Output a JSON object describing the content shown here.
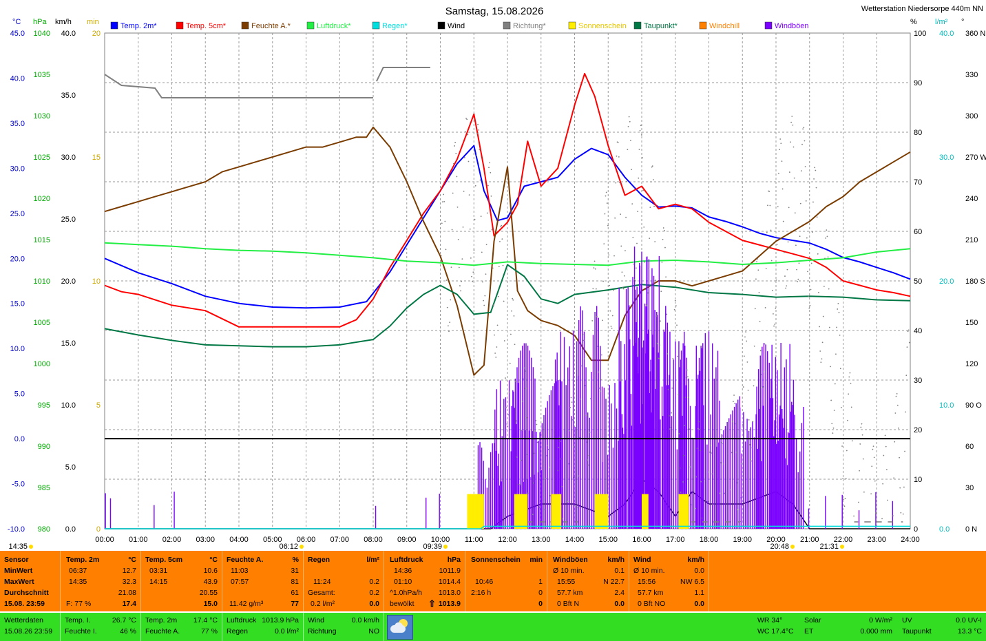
{
  "header": {
    "title": "Samstag, 15.08.2026",
    "station": "Wetterstation Niedersorpe 440m NN"
  },
  "axis_units": {
    "temp": "°C",
    "hpa": "hPa",
    "kmh": "km/h",
    "min": "min",
    "pct": "%",
    "lm2": "l/m²",
    "deg": "°"
  },
  "legend": [
    {
      "label": "Temp. 2m*",
      "color": "#0000ff"
    },
    {
      "label": "Temp. 5cm*",
      "color": "#ff0000"
    },
    {
      "label": "Feuchte A.*",
      "color": "#7a3c00"
    },
    {
      "label": "Luftdruck*",
      "color": "#22ee44"
    },
    {
      "label": "Regen*",
      "color": "#00dddd"
    },
    {
      "label": "Wind",
      "color": "#000000"
    },
    {
      "label": "Richtung*",
      "color": "#808080"
    },
    {
      "label": "Sonnenschein",
      "color": "#ffee00"
    },
    {
      "label": "Taupunkt*",
      "color": "#007744"
    },
    {
      "label": "Windchill",
      "color": "#ff8000"
    },
    {
      "label": "Windböen",
      "color": "#7a00ff"
    }
  ],
  "chart_data": {
    "type": "line",
    "title": "Samstag, 15.08.2026",
    "x_ticks": [
      "00:00",
      "01:00",
      "02:00",
      "03:00",
      "04:00",
      "05:00",
      "06:00",
      "07:00",
      "08:00",
      "09:00",
      "10:00",
      "11:00",
      "12:00",
      "13:00",
      "14:00",
      "15:00",
      "16:00",
      "17:00",
      "18:00",
      "19:00",
      "20:00",
      "21:00",
      "22:00",
      "23:00",
      "24:00"
    ],
    "axes": {
      "temp_c": {
        "min": -10,
        "max": 45,
        "ticks": [
          "45.0",
          "40.0",
          "35.0",
          "30.0",
          "25.0",
          "20.0",
          "15.0",
          "10.0",
          "5.0",
          "0.0",
          "-5.0",
          "-10.0"
        ]
      },
      "pressure_hpa": {
        "min": 980,
        "max": 1040,
        "ticks": [
          "1040",
          "1035",
          "1030",
          "1025",
          "1020",
          "1015",
          "1010",
          "1005",
          "1000",
          "995",
          "990",
          "985",
          "980"
        ]
      },
      "wind_kmh": {
        "min": 0,
        "max": 40,
        "ticks": [
          "40.0",
          "35.0",
          "30.0",
          "25.0",
          "20.0",
          "15.0",
          "10.0",
          "5.0",
          "0.0"
        ]
      },
      "sun_min": {
        "min": 0,
        "max": 20,
        "ticks": [
          "20",
          "15",
          "10",
          "5",
          "0"
        ]
      },
      "humidity_pct": {
        "min": 0,
        "max": 100,
        "ticks": [
          "100",
          "90",
          "80",
          "70",
          "60",
          "50",
          "40",
          "30",
          "20",
          "10",
          "0"
        ]
      },
      "rain_lm2": {
        "min": 0,
        "max": 40,
        "ticks": [
          "40.0",
          "30.0",
          "20.0",
          "10.0",
          "0.0"
        ]
      },
      "direction_deg": {
        "min": 0,
        "max": 360,
        "ticks": [
          "360 N",
          "330",
          "300",
          "270 W",
          "240",
          "210",
          "180 S",
          "150",
          "120",
          "90 O",
          "60",
          "30",
          "0 N"
        ]
      }
    },
    "series": [
      {
        "name": "Temp. 2m*",
        "axis": "temp_c",
        "color": "#0000ff",
        "x": [
          0,
          1,
          2,
          3,
          4,
          5,
          6,
          7,
          7.8,
          8.5,
          9,
          9.5,
          10,
          10.5,
          11,
          11.3,
          11.7,
          12,
          12.5,
          13,
          13.5,
          14,
          14.5,
          15,
          15.5,
          16,
          16.5,
          17,
          17.5,
          18,
          18.5,
          19,
          19.5,
          20,
          20.5,
          21,
          21.5,
          22,
          22.5,
          23,
          23.5,
          24
        ],
        "y": [
          20.0,
          18.4,
          17.2,
          15.8,
          15.0,
          14.6,
          14.5,
          14.6,
          15.2,
          18.5,
          21.5,
          24.5,
          27.5,
          30.5,
          32.5,
          27.5,
          24.2,
          24.5,
          28.0,
          28.5,
          29.0,
          31.0,
          32.2,
          31.5,
          29.0,
          27.0,
          25.7,
          25.8,
          25.6,
          24.6,
          24.1,
          23.5,
          22.8,
          22.3,
          22.0,
          21.7,
          21.0,
          20.1,
          19.6,
          19.0,
          18.4,
          17.7
        ]
      },
      {
        "name": "Temp. 5cm*",
        "axis": "temp_c",
        "color": "#ff0000",
        "x": [
          0,
          0.5,
          1,
          2,
          3,
          4,
          5,
          6,
          7,
          7.5,
          8,
          8.5,
          9,
          9.5,
          10,
          10.5,
          11,
          11.3,
          11.6,
          12,
          12.3,
          12.6,
          13,
          13.5,
          14,
          14.3,
          14.6,
          15,
          15.5,
          16,
          16.5,
          17,
          17.5,
          18,
          18.5,
          19,
          19.5,
          20,
          20.5,
          21,
          21.5,
          22,
          22.5,
          23,
          23.5,
          24
        ],
        "y": [
          17.0,
          16.3,
          16.0,
          14.8,
          14.2,
          12.4,
          12.4,
          12.4,
          12.4,
          13.2,
          15.5,
          19.0,
          22.0,
          25.0,
          27.5,
          31.0,
          36.0,
          30.0,
          22.5,
          24.0,
          26.0,
          33.0,
          28.0,
          30.0,
          37.0,
          40.5,
          38.0,
          32.5,
          27.0,
          28.0,
          25.5,
          26.0,
          25.5,
          24.0,
          23.0,
          22.0,
          21.5,
          21.0,
          20.5,
          20.0,
          19.0,
          17.5,
          17.0,
          16.5,
          16.2,
          15.8
        ]
      },
      {
        "name": "Feuchte A.*",
        "axis": "humidity_pct",
        "color": "#7a3c00",
        "x": [
          0,
          0.5,
          1,
          1.5,
          2,
          2.5,
          3,
          3.5,
          4,
          4.5,
          5,
          5.5,
          6,
          6.5,
          7,
          7.5,
          7.8,
          8,
          8.5,
          9,
          9.5,
          10,
          10.5,
          11,
          11.3,
          11.6,
          12,
          12.3,
          12.6,
          13,
          13.5,
          14,
          14.5,
          15,
          15.5,
          16,
          16.5,
          17,
          17.5,
          18,
          18.5,
          19,
          19.5,
          20,
          20.5,
          21,
          21.5,
          22,
          22.5,
          23,
          23.5,
          24
        ],
        "y": [
          64,
          65,
          66,
          67,
          68,
          69,
          70,
          72,
          73,
          74,
          75,
          76,
          77,
          77,
          78,
          79,
          79,
          81,
          77,
          70,
          62,
          55,
          45,
          31,
          33,
          58,
          73,
          48,
          44,
          42,
          41,
          39,
          34,
          34,
          43,
          48,
          50,
          50,
          49,
          50,
          51,
          52,
          55,
          58,
          60,
          62,
          65,
          67,
          70,
          72,
          74,
          76
        ]
      },
      {
        "name": "Luftdruck*",
        "axis": "pressure_hpa",
        "color": "#22ee44",
        "x": [
          0,
          1,
          2,
          3,
          4,
          5,
          6,
          7,
          8,
          9,
          10,
          11,
          12,
          13,
          14,
          15,
          16,
          17,
          18,
          19,
          20,
          21,
          22,
          23,
          24
        ],
        "y": [
          1014.6,
          1014.4,
          1014.2,
          1013.9,
          1013.7,
          1013.6,
          1013.4,
          1013.1,
          1012.8,
          1012.4,
          1012.2,
          1011.9,
          1012.3,
          1012.1,
          1012.0,
          1011.9,
          1012.4,
          1012.5,
          1012.3,
          1012.0,
          1012.2,
          1012.5,
          1012.8,
          1013.5,
          1013.9
        ]
      },
      {
        "name": "Taupunkt*",
        "axis": "temp_c",
        "color": "#007744",
        "x": [
          0,
          1,
          2,
          3,
          4,
          5,
          6,
          7,
          8,
          8.5,
          9,
          9.5,
          10,
          10.5,
          11,
          11.5,
          12,
          12.5,
          13,
          13.5,
          14,
          15,
          16,
          17,
          18,
          19,
          20,
          21,
          22,
          23,
          24
        ],
        "y": [
          12.2,
          11.5,
          10.9,
          10.4,
          10.3,
          10.2,
          10.2,
          10.4,
          11.0,
          12.5,
          14.5,
          16.0,
          17.0,
          16.0,
          13.8,
          14.0,
          19.3,
          18.0,
          15.5,
          15.0,
          16.0,
          16.5,
          17.1,
          16.8,
          16.2,
          16.0,
          15.7,
          15.8,
          15.7,
          15.4,
          15.3
        ]
      },
      {
        "name": "Wind",
        "axis": "wind_kmh",
        "color": "#000000",
        "x": [
          0,
          11.5,
          12,
          13,
          14,
          15,
          15.5,
          16,
          16.5,
          17,
          17.5,
          18,
          19,
          20,
          20.5,
          21,
          22,
          23,
          24
        ],
        "y": [
          0,
          0,
          1,
          2,
          2,
          1,
          2,
          4,
          3,
          1,
          3,
          2,
          2,
          3,
          2,
          0,
          0,
          0,
          0
        ]
      },
      {
        "name": "Windböen",
        "axis": "wind_kmh",
        "color": "#7a00ff",
        "x": [
          0.05,
          0.2,
          1.5,
          2.1,
          8.1,
          9.6,
          10.0,
          11.0,
          11.5,
          12.0,
          12.5,
          12.7,
          13.3,
          13.8,
          14.5,
          15.2,
          15.7,
          16.0,
          16.2,
          16.5,
          17.0,
          17.5,
          18.0,
          18.6,
          19.3,
          19.8,
          20.2,
          20.5,
          21.0,
          21.5,
          22.0,
          22.5,
          23.0,
          23.5
        ],
        "y": [
          3,
          3,
          3,
          3,
          3,
          3,
          3,
          4,
          7,
          12,
          15,
          8,
          12,
          16,
          18,
          12,
          20,
          23,
          22,
          18,
          16,
          15,
          16,
          14,
          10,
          15,
          15,
          10,
          3,
          3,
          3,
          3,
          3,
          3
        ]
      },
      {
        "name": "Richtung*",
        "axis": "direction_deg",
        "color": "#808080",
        "x": [
          0,
          0.5,
          1,
          1.5,
          2,
          8,
          8.1,
          8.3,
          9.5,
          10,
          10.3,
          11,
          11.5,
          12,
          13,
          14,
          15,
          16,
          17,
          18,
          20,
          21,
          22,
          23,
          23.5,
          24
        ],
        "y": [
          330,
          322,
          320,
          315,
          312,
          312,
          325,
          335,
          335,
          180,
          150,
          130,
          210,
          230,
          170,
          200,
          230,
          210,
          240,
          280,
          150,
          150,
          130,
          80,
          40,
          30
        ]
      },
      {
        "name": "Sonnenschein",
        "axis": "sun_min",
        "color": "#ffee00",
        "x": [
          10.8,
          11.3,
          12.2,
          12.6,
          13.3,
          13.6,
          14.6,
          15.0,
          16.0,
          16.2,
          17.1,
          17.4
        ],
        "y": [
          1,
          0,
          1,
          0,
          1,
          1,
          1,
          0,
          1,
          0,
          1,
          0
        ]
      },
      {
        "name": "Regen*",
        "axis": "rain_lm2",
        "color": "#00dddd",
        "x": [
          0,
          11.2,
          11.3,
          24
        ],
        "y": [
          0,
          0,
          0.2,
          0.2
        ]
      }
    ],
    "markers": [
      {
        "label": "14:35"
      },
      {
        "label": "06:12"
      },
      {
        "label": "09:39"
      },
      {
        "label": "20:48"
      },
      {
        "label": "21:31"
      }
    ]
  },
  "stats": {
    "sensor": {
      "title": "Sensor",
      "rows": [
        "MinWert",
        "MaxWert",
        "Durchschnitt",
        "15.08. 23:59"
      ]
    },
    "temp2m": {
      "title": "Temp. 2m",
      "unit": "°C",
      "min_time": "06:37",
      "min_val": "12.7",
      "max_time": "14:35",
      "max_val": "32.3",
      "avg": "21.08",
      "cur_label": "F: 77 %",
      "cur": "17.4"
    },
    "temp5cm": {
      "title": "Temp. 5cm",
      "unit": "°C",
      "min_time": "03:31",
      "min_val": "10.6",
      "max_time": "14:15",
      "max_val": "43.9",
      "avg": "20.55",
      "cur": "15.0"
    },
    "feuchte": {
      "title": "Feuchte A.",
      "unit": "%",
      "min_time": "11:03",
      "min_val": "31",
      "max_time": "07:57",
      "max_val": "81",
      "avg": "61",
      "cur_label": "11.42 g/m³",
      "cur": "77"
    },
    "regen": {
      "title": "Regen",
      "unit": "l/m²",
      "r1_time": "11:24",
      "r1_val": "0.2",
      "r2_label": "Gesamt:",
      "r2_val": "0.2",
      "cur_label": "0.2 l/m²",
      "cur": "0.0"
    },
    "luftdruck": {
      "title": "Luftdruck",
      "unit": "hPa",
      "min_time": "14:36",
      "min_val": "1011.9",
      "max_time": "01:10",
      "max_val": "1014.4",
      "avg_label": "^1.0hPa/h",
      "avg": "1013.0",
      "cur_label": "bewölkt",
      "cur_arrow": "⇧",
      "cur": "1013.9"
    },
    "sonne": {
      "title": "Sonnenschein",
      "unit": "min",
      "r1_time": "10:46",
      "r1_val": "1",
      "r2_label": "2:16 h",
      "r2_val": "0",
      "cur": "0"
    },
    "windboeen": {
      "title": "Windböen",
      "unit": "km/h",
      "r1_label": "Ø 10 min.",
      "r1_val": "0.1",
      "r2_time": "15:55",
      "r2_val": "N 22.7",
      "r3_label": "57.7 km",
      "r3_val": "2.4",
      "cur_label": "0 Bft N",
      "cur": "0.0"
    },
    "wind": {
      "title": "Wind",
      "unit": "km/h",
      "r1_label": "Ø 10 min.",
      "r1_val": "0.0",
      "r2_time": "15:56",
      "r2_val": "NW 6.5",
      "r3_label": "57.7 km",
      "r3_val": "1.1",
      "cur_label": "0 Bft NO",
      "cur": "0.0"
    }
  },
  "current": {
    "c1": {
      "l1": "Wetterdaten",
      "l2": "15.08.26 23:59"
    },
    "c2": {
      "l1": "Temp. I.",
      "v1": "26.7 °C",
      "l2": "Feuchte I.",
      "v2": "46 %"
    },
    "c3": {
      "l1": "Temp. 2m",
      "v1": "17.4 °C",
      "l2": "Feuchte A.",
      "v2": "77 %"
    },
    "c4": {
      "l1": "Luftdruck",
      "v1": "1013.9 hPa",
      "l2": "Regen",
      "v2": "0.0 l/m²"
    },
    "c5": {
      "l1": "Wind",
      "v1": "0.0 km/h",
      "l2": "Richtung",
      "v2": "NO"
    },
    "c6": {
      "l1": "WR 34°",
      "l2": "WC 17.4°C"
    },
    "c7": {
      "l1": "Solar",
      "v1": "0 W/m²",
      "l2": "ET",
      "v2": "0.000 mm"
    },
    "c8": {
      "l1": "UV",
      "v1": "0.0 UV-I",
      "l2": "Taupunkt",
      "v2": "13.3 °C"
    },
    "weather_icon": "cloud-sun-icon"
  }
}
